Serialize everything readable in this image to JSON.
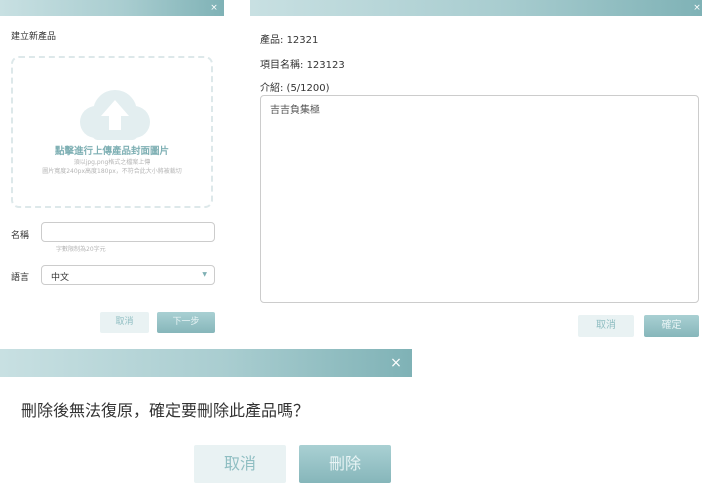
{
  "create_dialog": {
    "close_glyph": "×",
    "title": "建立新產品",
    "upload": {
      "title": "點擊進行上傳產品封面圖片",
      "hint_line1": "須以jpg,png格式之檔案上傳",
      "hint_line2": "圖片寬度240px高度180px，不符合此大小將被裁切"
    },
    "name_label": "名稱",
    "name_value": "",
    "name_hint": "字數限制為20字元",
    "language_label": "語言",
    "language_value": "中文",
    "cancel_label": "取消",
    "next_label": "下一步"
  },
  "edit_dialog": {
    "close_glyph": "×",
    "product_label": "產品: ",
    "product_value": "12321",
    "item_name_label": "項目名稱: ",
    "item_name_value": "123123",
    "intro_label": "介紹: (5/1200)",
    "intro_text": "吉吉負集極",
    "cancel_label": "取消",
    "confirm_label": "確定"
  },
  "delete_dialog": {
    "close_glyph": "×",
    "message": "刪除後無法復原，確定要刪除此產品嗎？",
    "cancel_label": "取消",
    "delete_label": "刪除"
  }
}
